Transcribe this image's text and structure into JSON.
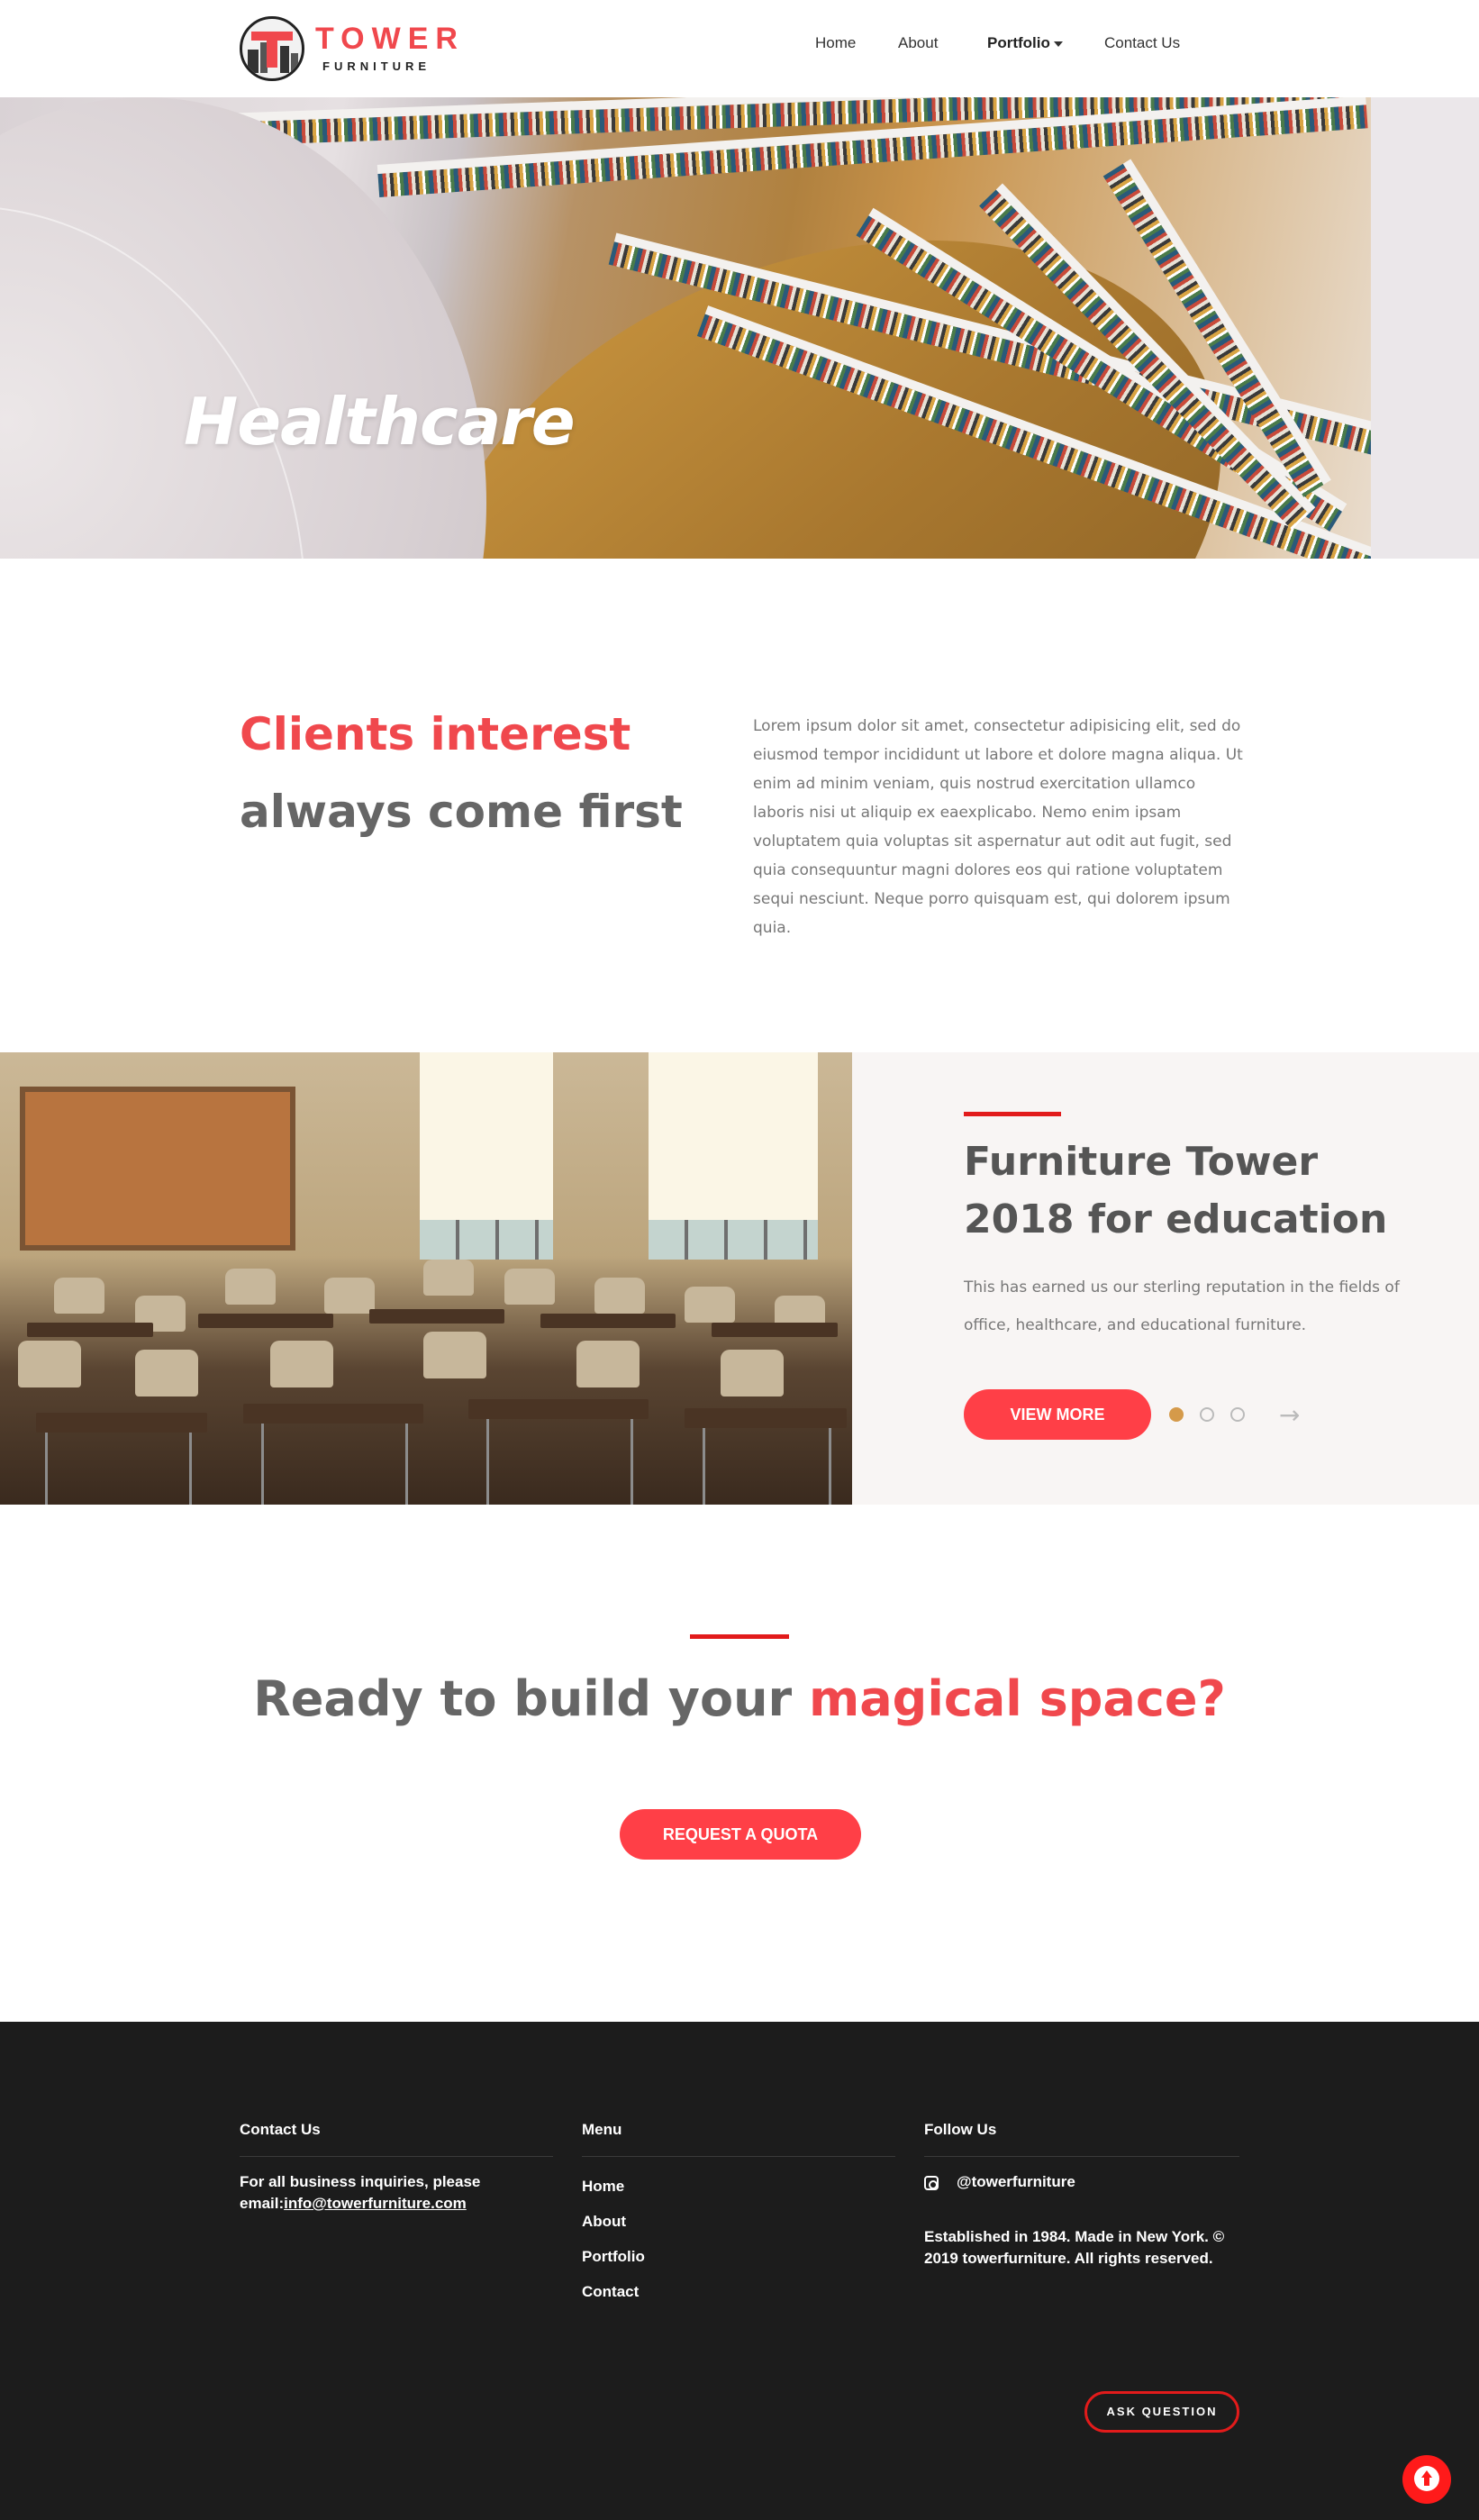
{
  "brand": {
    "name": "TOWER",
    "sub": "FURNITURE",
    "accent": "#f0484d"
  },
  "nav": {
    "home": "Home",
    "about": "About",
    "portfolio": "Portfolio",
    "contact": "Contact Us"
  },
  "hero": {
    "title": "Healthcare"
  },
  "intro": {
    "heading_red": "Clients interest",
    "heading_grey": "always come first",
    "body": "Lorem ipsum dolor sit amet, consectetur adipisicing elit, sed do eiusmod tempor incididunt ut labore et dolore magna aliqua. Ut enim ad minim veniam, quis nostrud exercitation ullamco laboris nisi ut aliquip ex eaexplicabo. Nemo enim ipsam voluptatem quia voluptas sit aspernatur aut odit aut fugit, sed quia consequuntur magni dolores eos qui ratione voluptatem sequi nesciunt. Neque porro quisquam est, qui dolorem ipsum quia."
  },
  "education": {
    "title": "Furniture Tower 2018 for education",
    "description": "This has earned us our sterling reputation in the fields of office, healthcare, and educational furniture.",
    "button": "VIEW MORE",
    "slides": 3,
    "active_slide": 1
  },
  "cta": {
    "title_plain": "Ready to build your ",
    "title_accent": "magical space?",
    "button": "REQUEST A QUOTA"
  },
  "footer": {
    "contact_heading": "Contact Us",
    "contact_text": "For all business inquiries, please email:",
    "contact_email": "info@towerfurniture.com",
    "menu_heading": "Menu",
    "menu_items": [
      "Home",
      "About",
      "Portfolio",
      "Contact"
    ],
    "follow_heading": "Follow Us",
    "instagram": "@towerfurniture",
    "legal": "Established in 1984. Made in New York. © 2019 towerfurniture. All rights reserved.",
    "ask_button": "ASK QUESTION"
  },
  "icons": {
    "instagram": "instagram-icon",
    "back_to_top": "arrow-up-icon",
    "carousel_next": "arrow-right-icon",
    "caret": "chevron-down-icon"
  }
}
